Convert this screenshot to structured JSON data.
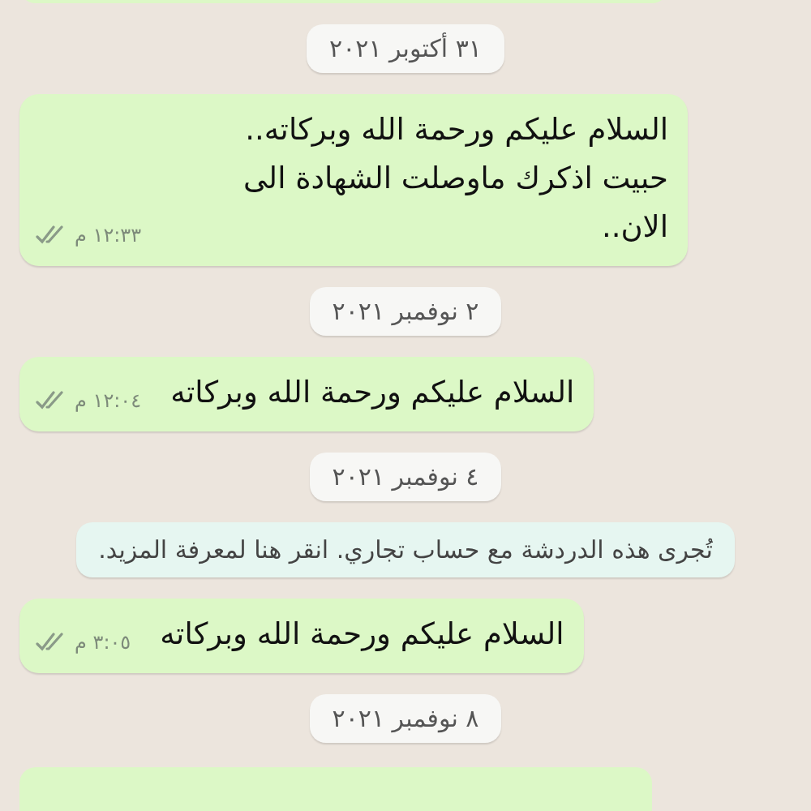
{
  "chat": [
    {
      "kind": "cut_bubble"
    },
    {
      "kind": "date",
      "text": "٣١ أكتوبر ٢٠٢١"
    },
    {
      "kind": "message",
      "text": "السلام عليكم ورحمة الله وبركاته.. حبيت اذكرك ماوصلت الشهادة الى الان..",
      "time": "١٢:٣٣ م"
    },
    {
      "kind": "date",
      "text": "٢ نوفمبر ٢٠٢١"
    },
    {
      "kind": "message",
      "text": "السلام عليكم ورحمة الله وبركاته",
      "time": "١٢:٠٤ م"
    },
    {
      "kind": "date",
      "text": "٤ نوفمبر ٢٠٢١"
    },
    {
      "kind": "notice",
      "text": "تُجرى هذه الدردشة مع حساب تجاري. انقر هنا لمعرفة المزيد."
    },
    {
      "kind": "message",
      "text": "السلام عليكم ورحمة الله وبركاته",
      "time": "٣:٠٥ م"
    },
    {
      "kind": "date",
      "text": "٨ نوفمبر ٢٠٢١"
    },
    {
      "kind": "cut_bubble"
    }
  ]
}
